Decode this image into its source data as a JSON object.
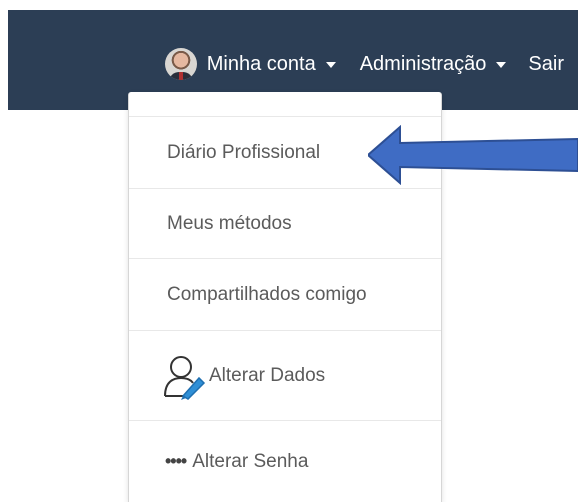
{
  "navbar": {
    "account_label": "Minha conta",
    "admin_label": "Administração",
    "logout_label": "Sair"
  },
  "dropdown": {
    "items": [
      {
        "label": "Diário Profissional"
      },
      {
        "label": "Meus métodos"
      },
      {
        "label": "Compartilhados comigo"
      },
      {
        "label": "Alterar Dados",
        "icon": "user-edit-icon"
      },
      {
        "label": "Alterar Senha",
        "icon": "password-dots-icon",
        "icon_text": "••••"
      }
    ]
  },
  "annotation": {
    "arrow_color": "#3f6cc4",
    "icon": "arrow-left-icon"
  },
  "colors": {
    "navbar_bg": "#2c3e55",
    "text": "#5b5b5b",
    "icon_accent": "#2f8fd6"
  }
}
